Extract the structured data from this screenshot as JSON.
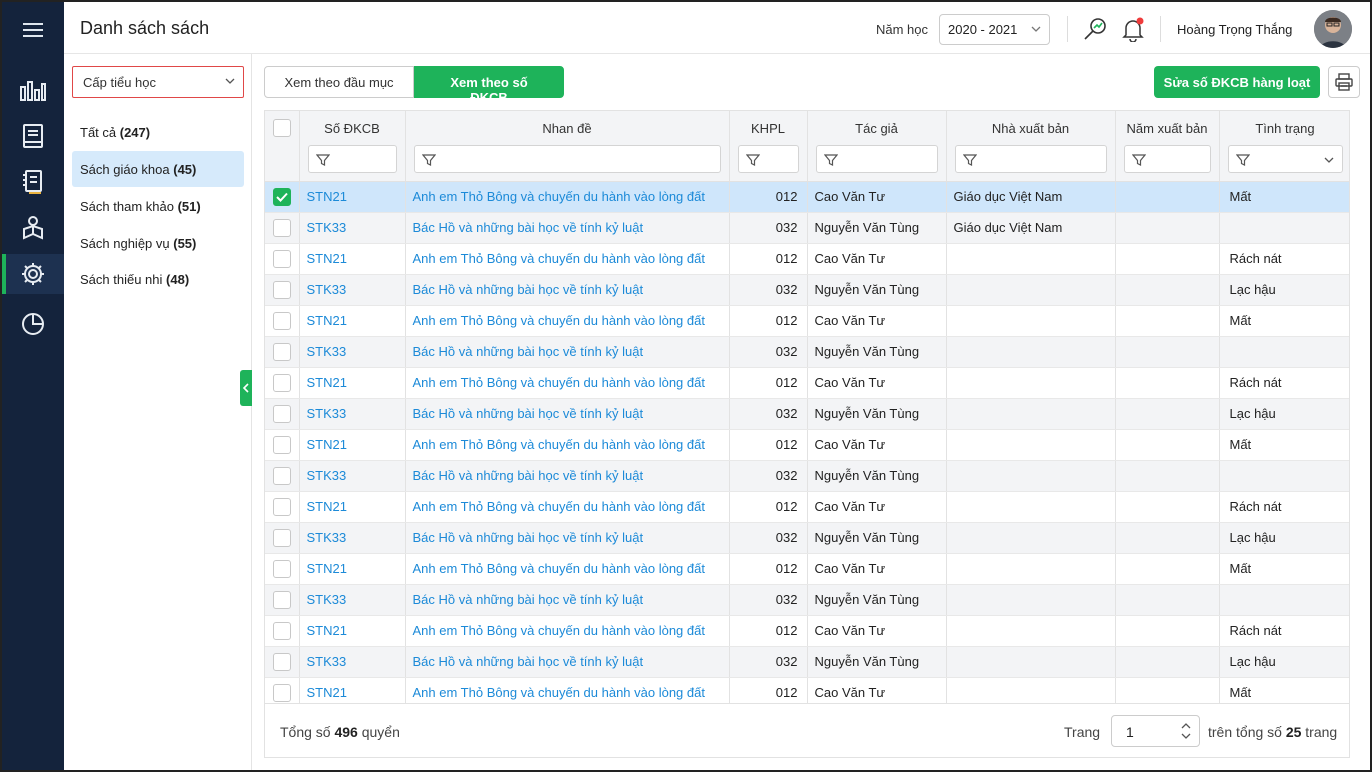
{
  "header": {
    "title": "Danh sách sách",
    "year_label": "Năm học",
    "year_value": "2020 - 2021",
    "user_name": "Hoàng Trọng  Thắng"
  },
  "nav": {
    "items": [
      "menu-icon",
      "dashboard-icon",
      "book-icon",
      "checklist-book-icon",
      "reader-icon",
      "settings-icon",
      "pie-chart-icon"
    ],
    "active": "settings-icon",
    "accent": "#1eb35a"
  },
  "sidebar": {
    "level_select": "Cấp tiểu học",
    "categories": [
      {
        "label": "Tất cả",
        "count": "(247)"
      },
      {
        "label": "Sách giáo khoa",
        "count": "(45)"
      },
      {
        "label": "Sách tham khảo",
        "count": "(51)"
      },
      {
        "label": "Sách nghiệp vụ",
        "count": "(55)"
      },
      {
        "label": "Sách thiếu nhi",
        "count": "(48)"
      }
    ]
  },
  "toolbar": {
    "tab_category": "Xem theo đầu mục",
    "tab_dkcb": "Xem theo số ĐKCB",
    "bulk_edit": "Sửa số ĐKCB hàng loạt"
  },
  "table": {
    "columns": [
      "Số ĐKCB",
      "Nhan đề",
      "KHPL",
      "Tác giả",
      "Nhà xuất bản",
      "Năm xuất bản",
      "Tình trạng"
    ],
    "rows": [
      {
        "code": "STN21",
        "title": "Anh em Thỏ Bông và chuyến du hành vào lòng đất",
        "khpl": "012",
        "author": "Cao Văn Tư",
        "publisher": "Giáo dục Việt Nam",
        "year": "",
        "status": "Mất",
        "checked": true
      },
      {
        "code": "STK33",
        "title": "Bác Hồ và những bài học về tính kỷ luật",
        "khpl": "032",
        "author": "Nguyễn Văn Tùng",
        "publisher": "Giáo dục Việt Nam",
        "year": "",
        "status": "",
        "checked": false
      },
      {
        "code": "STN21",
        "title": "Anh em Thỏ Bông và chuyến du hành vào lòng đất",
        "khpl": "012",
        "author": "Cao Văn Tư",
        "publisher": "",
        "year": "",
        "status": "Rách nát",
        "checked": false
      },
      {
        "code": "STK33",
        "title": "Bác Hồ và những bài học về tính kỷ luật",
        "khpl": "032",
        "author": "Nguyễn Văn Tùng",
        "publisher": "",
        "year": "",
        "status": "Lạc hậu",
        "checked": false
      },
      {
        "code": "STN21",
        "title": "Anh em Thỏ Bông và chuyến du hành vào lòng đất",
        "khpl": "012",
        "author": "Cao Văn Tư",
        "publisher": "",
        "year": "",
        "status": "Mất",
        "checked": false
      },
      {
        "code": "STK33",
        "title": "Bác Hồ và những bài học về tính kỷ luật",
        "khpl": "032",
        "author": "Nguyễn Văn Tùng",
        "publisher": "",
        "year": "",
        "status": "",
        "checked": false
      },
      {
        "code": "STN21",
        "title": "Anh em Thỏ Bông và chuyến du hành vào lòng đất",
        "khpl": "012",
        "author": "Cao Văn Tư",
        "publisher": "",
        "year": "",
        "status": "Rách nát",
        "checked": false
      },
      {
        "code": "STK33",
        "title": "Bác Hồ và những bài học về tính kỷ luật",
        "khpl": "032",
        "author": "Nguyễn Văn Tùng",
        "publisher": "",
        "year": "",
        "status": "Lạc hậu",
        "checked": false
      },
      {
        "code": "STN21",
        "title": "Anh em Thỏ Bông và chuyến du hành vào lòng đất",
        "khpl": "012",
        "author": "Cao Văn Tư",
        "publisher": "",
        "year": "",
        "status": "Mất",
        "checked": false
      },
      {
        "code": "STK33",
        "title": "Bác Hồ và những bài học về tính kỷ luật",
        "khpl": "032",
        "author": "Nguyễn Văn Tùng",
        "publisher": "",
        "year": "",
        "status": "",
        "checked": false
      },
      {
        "code": "STN21",
        "title": "Anh em Thỏ Bông và chuyến du hành vào lòng đất",
        "khpl": "012",
        "author": "Cao Văn Tư",
        "publisher": "",
        "year": "",
        "status": "Rách nát",
        "checked": false
      },
      {
        "code": "STK33",
        "title": "Bác Hồ và những bài học về tính kỷ luật",
        "khpl": "032",
        "author": "Nguyễn Văn Tùng",
        "publisher": "",
        "year": "",
        "status": "Lạc hậu",
        "checked": false
      },
      {
        "code": "STN21",
        "title": "Anh em Thỏ Bông và chuyến du hành vào lòng đất",
        "khpl": "012",
        "author": "Cao Văn Tư",
        "publisher": "",
        "year": "",
        "status": "Mất",
        "checked": false
      },
      {
        "code": "STK33",
        "title": "Bác Hồ và những bài học về tính kỷ luật",
        "khpl": "032",
        "author": "Nguyễn Văn Tùng",
        "publisher": "",
        "year": "",
        "status": "",
        "checked": false
      },
      {
        "code": "STN21",
        "title": "Anh em Thỏ Bông và chuyến du hành vào lòng đất",
        "khpl": "012",
        "author": "Cao Văn Tư",
        "publisher": "",
        "year": "",
        "status": "Rách nát",
        "checked": false
      },
      {
        "code": "STK33",
        "title": "Bác Hồ và những bài học về tính kỷ luật",
        "khpl": "032",
        "author": "Nguyễn Văn Tùng",
        "publisher": "",
        "year": "",
        "status": "Lạc hậu",
        "checked": false
      },
      {
        "code": "STN21",
        "title": "Anh em Thỏ Bông và chuyến du hành vào lòng đất",
        "khpl": "012",
        "author": "Cao Văn Tư",
        "publisher": "",
        "year": "",
        "status": "Mất",
        "checked": false
      }
    ]
  },
  "footer": {
    "total_prefix": "Tổng số",
    "total_count": "496",
    "total_suffix": "quyển",
    "page_label": "Trang",
    "page_value": "1",
    "pages_prefix": "trên tổng số",
    "pages_count": "25",
    "pages_suffix": "trang"
  }
}
